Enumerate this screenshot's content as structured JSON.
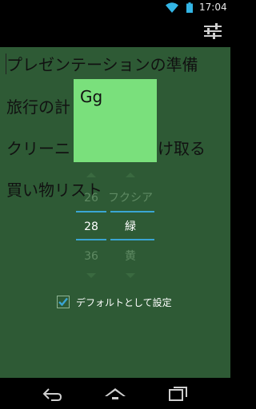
{
  "status_bar": {
    "time": "17:04",
    "icons": [
      "wifi-icon",
      "battery-icon"
    ]
  },
  "action_bar": {
    "icons": [
      "settings-sliders-icon"
    ]
  },
  "list": {
    "items": [
      "プレゼンテーションの準備",
      "旅行の計",
      "クリーニ",
      "け取る",
      "買い物リスト"
    ]
  },
  "preview": {
    "text": "Gg",
    "color": "#7ae07c"
  },
  "size_picker": {
    "previous": "26",
    "selected": "28",
    "next": "36"
  },
  "color_picker": {
    "previous": "フクシア",
    "selected": "緑",
    "next": "黄"
  },
  "default_checkbox": {
    "label": "デフォルトとして設定",
    "checked": true,
    "accent": "#3aa5d3"
  },
  "nav_bar": {
    "icons": [
      "back-icon",
      "home-icon",
      "recents-icon"
    ]
  }
}
